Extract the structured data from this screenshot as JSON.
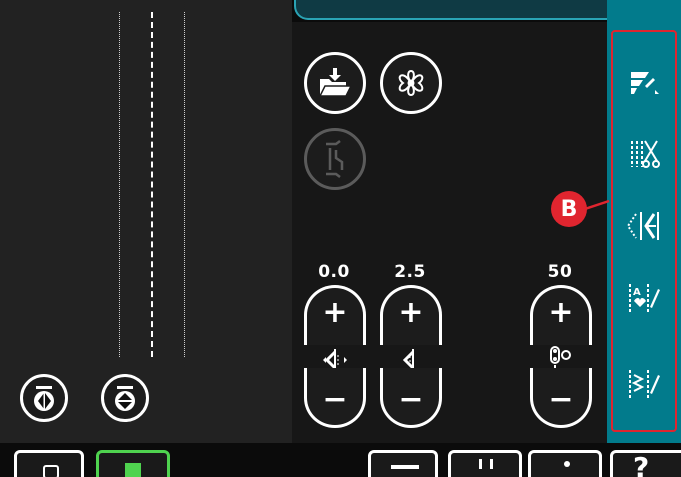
{
  "values": {
    "stitch_width": "0.0",
    "stitch_length": "2.5",
    "speed": "50"
  },
  "callout": {
    "label": "B"
  },
  "colors": {
    "sidebar": "#027b8c",
    "highlight_border": "#e0252f",
    "active_tab": "#4fd34f"
  },
  "icons": {
    "load": "load-folder-icon",
    "fan": "fan-icon",
    "tapering": "tapering-icon",
    "mirror_side": "mirror-side-icon",
    "mirror_end": "mirror-end-icon",
    "width": "stitch-width-icon",
    "length": "stitch-length-icon",
    "speed": "speed-icon",
    "sidebar": [
      "stitch-menu-icon",
      "cut-icon",
      "balance-icon",
      "program-icon",
      "save-stitch-icon"
    ]
  }
}
